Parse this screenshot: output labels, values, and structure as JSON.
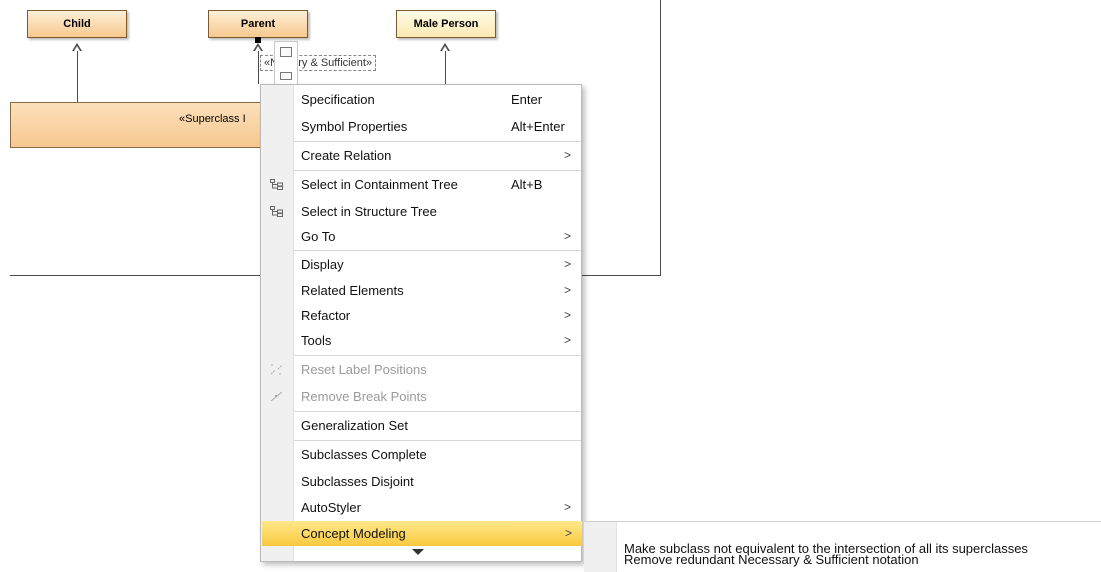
{
  "diagram": {
    "classes": {
      "child": "Child",
      "parent": "Parent",
      "male_person": "Male Person"
    },
    "superclass_label": "«Superclass I",
    "necessary_sufficient_label": "«N  ssary & Sufficient»"
  },
  "context_menu": {
    "items": [
      {
        "label": "Specification",
        "shortcut": "Enter"
      },
      {
        "label": "Symbol Properties",
        "shortcut": "Alt+Enter"
      },
      {
        "label": "Create Relation",
        "arrow": ">"
      },
      {
        "label": "Select in Containment Tree",
        "shortcut": "Alt+B",
        "icon": "containment-tree-icon"
      },
      {
        "label": "Select in Structure Tree",
        "icon": "structure-tree-icon"
      },
      {
        "label": "Go To",
        "arrow": ">"
      },
      {
        "label": "Display",
        "arrow": ">"
      },
      {
        "label": "Related Elements",
        "arrow": ">"
      },
      {
        "label": "Refactor",
        "arrow": ">"
      },
      {
        "label": "Tools",
        "arrow": ">"
      },
      {
        "label": "Reset Label Positions",
        "disabled": true,
        "icon": "reset-label-icon"
      },
      {
        "label": "Remove Break Points",
        "disabled": true,
        "icon": "break-points-icon"
      },
      {
        "label": "Generalization Set"
      },
      {
        "label": "Subclasses Complete"
      },
      {
        "label": "Subclasses Disjoint"
      },
      {
        "label": "AutoStyler",
        "arrow": ">"
      },
      {
        "label": "Concept Modeling",
        "arrow": ">",
        "highlighted": true
      }
    ]
  },
  "submenu": {
    "items": [
      "Make subclass not equivalent to the intersection of all its superclasses",
      "Remove redundant Necessary & Sufficient notation"
    ]
  },
  "colors": {
    "class_fill": "#f6c88e",
    "highlight": "#f9c93f",
    "menu_gutter": "#f0f0f0"
  }
}
